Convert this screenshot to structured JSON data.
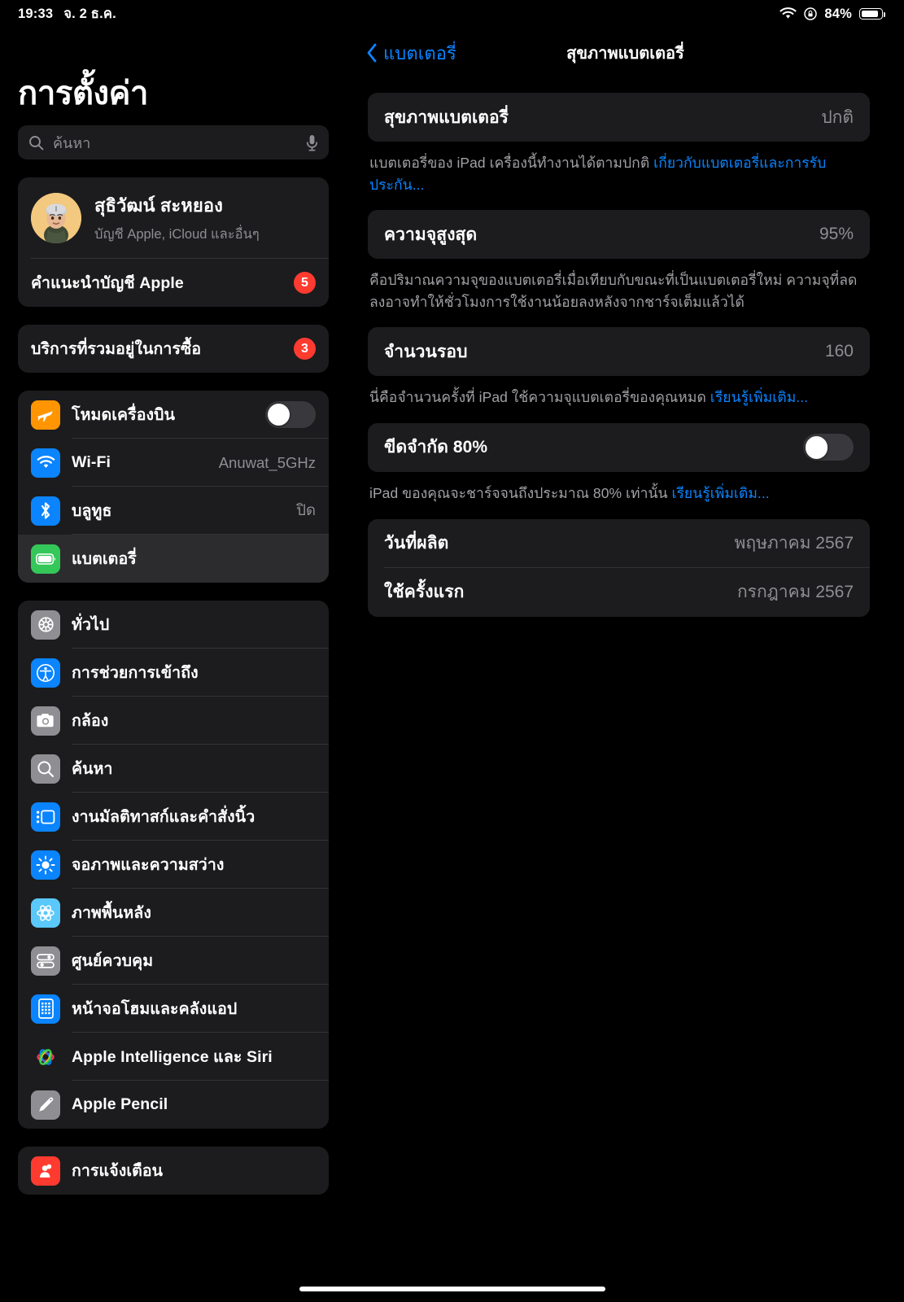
{
  "status_bar": {
    "time": "19:33",
    "date": "จ. 2 ธ.ค.",
    "wifi_icon": "wifi-icon",
    "lock_icon": "rotation-lock-icon",
    "battery_percent": "84%",
    "battery_level": 84,
    "battery_icon": "battery-icon"
  },
  "sidebar": {
    "title": "การตั้งค่า",
    "search": {
      "placeholder": "ค้นหา",
      "value": "",
      "search_icon": "search-icon",
      "mic_icon": "microphone-icon"
    },
    "account": {
      "name": "สุธิวัฒน์ สะหยอง",
      "subtitle": "บัญชี Apple, iCloud และอื่นๆ",
      "avatar_icon": "memoji-avatar",
      "recommendation_label": "คำแนะนำบัญชี Apple",
      "recommendation_badge": "5"
    },
    "services": {
      "label": "บริการที่รวมอยู่ในการซื้อ",
      "badge": "3"
    },
    "connectivity": [
      {
        "label": "โหมดเครื่องบิน",
        "icon": "airplane-icon",
        "icon_color": "#ff9500",
        "control": "toggle",
        "toggle_on": false
      },
      {
        "label": "Wi-Fi",
        "icon": "wifi-icon",
        "icon_color": "#0a84ff",
        "control": "value",
        "value": "Anuwat_5GHz"
      },
      {
        "label": "บลูทูธ",
        "icon": "bluetooth-icon",
        "icon_color": "#0a84ff",
        "control": "value",
        "value": "ปิด"
      },
      {
        "label": "แบตเตอรี่",
        "icon": "battery-icon",
        "icon_color": "#34c759",
        "control": "none",
        "value": "",
        "selected": true
      }
    ],
    "general": [
      {
        "label": "ทั่วไป",
        "icon": "gear-icon",
        "icon_color": "#8e8e93"
      },
      {
        "label": "การช่วยการเข้าถึง",
        "icon": "accessibility-icon",
        "icon_color": "#0a84ff"
      },
      {
        "label": "กล้อง",
        "icon": "camera-icon",
        "icon_color": "#8e8e93"
      },
      {
        "label": "ค้นหา",
        "icon": "search-icon",
        "icon_color": "#8e8e93"
      },
      {
        "label": "งานมัลติทาสก์และคำสั่งนิ้ว",
        "icon": "multitasking-icon",
        "icon_color": "#0a84ff"
      },
      {
        "label": "จอภาพและความสว่าง",
        "icon": "brightness-icon",
        "icon_color": "#0a84ff"
      },
      {
        "label": "ภาพพื้นหลัง",
        "icon": "wallpaper-icon",
        "icon_color": "#5ac8fa"
      },
      {
        "label": "ศูนย์ควบคุม",
        "icon": "control-center-icon",
        "icon_color": "#8e8e93"
      },
      {
        "label": "หน้าจอโฮมและคลังแอป",
        "icon": "home-screen-icon",
        "icon_color": "#0a84ff"
      },
      {
        "label": "Apple Intelligence และ Siri",
        "icon": "apple-intelligence-icon",
        "icon_color": "#1c1c1e"
      },
      {
        "label": "Apple Pencil",
        "icon": "pencil-icon",
        "icon_color": "#8e8e93"
      }
    ],
    "bottom_partial": [
      {
        "label": "การแจ้งเตือน",
        "icon": "notifications-icon",
        "icon_color": "#ff3b30"
      }
    ]
  },
  "detail": {
    "back_label": "แบตเตอรี่",
    "back_icon": "chevron-left-icon",
    "title": "สุขภาพแบตเตอรี่",
    "sections": [
      {
        "rows": [
          {
            "label": "สุขภาพแบตเตอรี่",
            "value": "ปกติ",
            "control": "value"
          }
        ],
        "note": "แบตเตอรี่ของ iPad เครื่องนี้ทำงานได้ตามปกติ ",
        "note_link": "เกี่ยวกับแบตเตอรี่และการรับประกัน..."
      },
      {
        "rows": [
          {
            "label": "ความจุสูงสุด",
            "value": "95%",
            "control": "value"
          }
        ],
        "note": "คือปริมาณความจุของแบตเตอรี่เมื่อเทียบกับขณะที่เป็นแบตเตอรี่ใหม่ ความจุที่ลดลงอาจทำให้ชั่วโมงการใช้งานน้อยลงหลังจากชาร์จเต็มแล้วได้",
        "note_link": ""
      },
      {
        "rows": [
          {
            "label": "จำนวนรอบ",
            "value": "160",
            "control": "value"
          }
        ],
        "note": "นี่คือจำนวนครั้งที่ iPad ใช้ความจุแบตเตอรี่ของคุณหมด ",
        "note_link": "เรียนรู้เพิ่มเติม..."
      },
      {
        "rows": [
          {
            "label": "ขีดจำกัด 80%",
            "value": "",
            "control": "toggle",
            "toggle_on": false
          }
        ],
        "note": "iPad ของคุณจะชาร์จจนถึงประมาณ 80% เท่านั้น ",
        "note_link": "เรียนรู้เพิ่มเติม..."
      },
      {
        "rows": [
          {
            "label": "วันที่ผลิต",
            "value": "พฤษภาคม 2567",
            "control": "value"
          },
          {
            "label": "ใช้ครั้งแรก",
            "value": "กรกฎาคม 2567",
            "control": "value"
          }
        ],
        "note": "",
        "note_link": ""
      }
    ]
  },
  "colors": {
    "background": "#000000",
    "card": "#1c1c1e",
    "selected_row": "#2c2c2e",
    "accent_blue": "#0a84ff",
    "badge_red": "#ff3b30",
    "toggle_on": "#34c759",
    "secondary_text": "#8e8e93"
  }
}
